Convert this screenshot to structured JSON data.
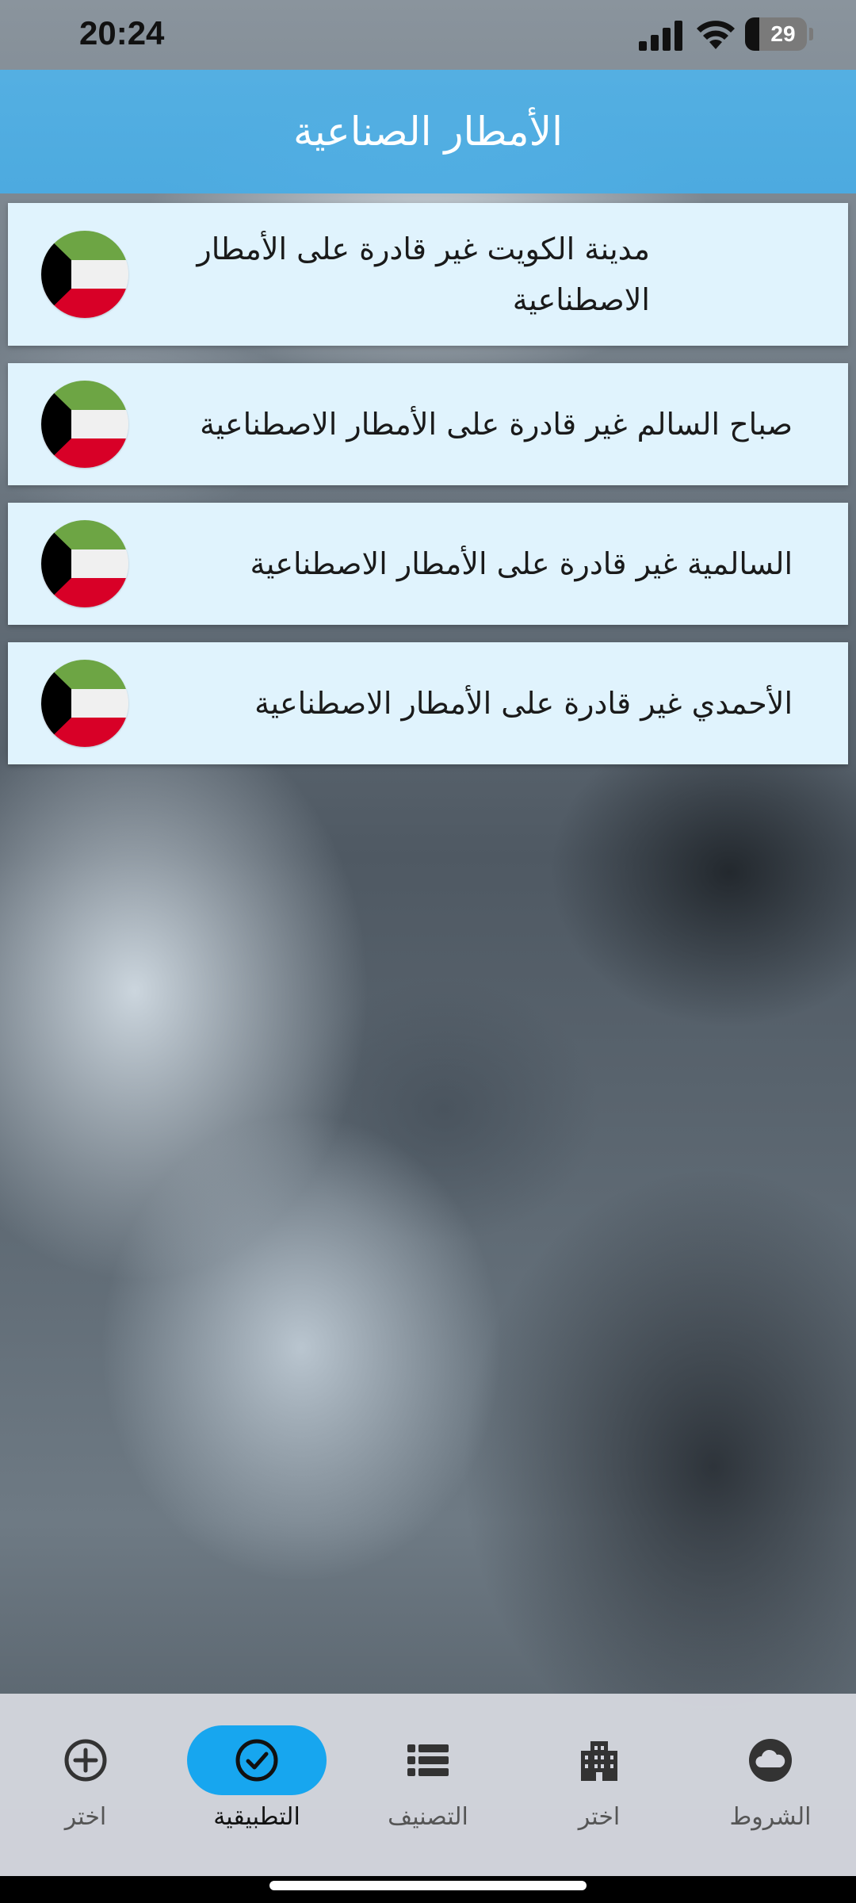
{
  "status_bar": {
    "time": "20:24",
    "battery": "29",
    "icons": [
      "signal-icon",
      "wifi-icon",
      "battery-icon"
    ]
  },
  "header": {
    "title": "الأمطار الصناعية"
  },
  "cities": [
    {
      "text": "مدينة الكويت غير قادرة على الأمطار الاصطناعية",
      "icon": "kuwait-flag-icon"
    },
    {
      "text": "صباح السالم غير قادرة على الأمطار الاصطناعية",
      "icon": "kuwait-flag-icon"
    },
    {
      "text": "السالمية غير قادرة على الأمطار الاصطناعية",
      "icon": "kuwait-flag-icon"
    },
    {
      "text": "الأحمدي غير قادرة على الأمطار الاصطناعية",
      "icon": "kuwait-flag-icon"
    }
  ],
  "bottom_nav": {
    "items": [
      {
        "label": "اختر",
        "icon": "plus-circle-icon",
        "active": false
      },
      {
        "label": "التطبيقية",
        "icon": "check-circle-icon",
        "active": true
      },
      {
        "label": "التصنيف",
        "icon": "list-icon",
        "active": false
      },
      {
        "label": "اختر",
        "icon": "building-icon",
        "active": false
      },
      {
        "label": "الشروط",
        "icon": "cloud-icon",
        "active": false
      }
    ]
  },
  "colors": {
    "header": "#4cb0e6",
    "card": "#e0f3fd",
    "active_nav": "#17a6ef",
    "flag_green": "#6da544",
    "flag_white": "#f0f0f0",
    "flag_red": "#d80027"
  }
}
